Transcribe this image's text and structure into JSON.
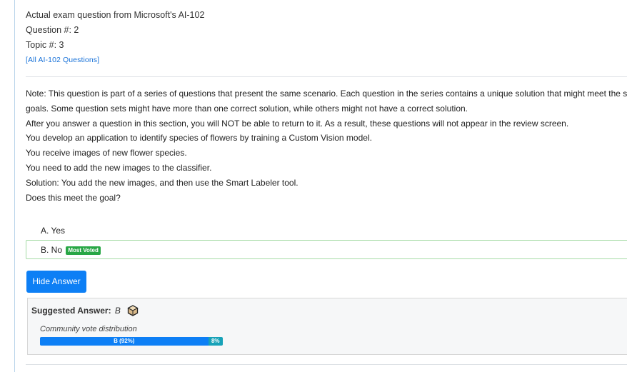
{
  "header": {
    "exam_line": "Actual exam question from Microsoft's AI-102",
    "question_number": "Question #: 2",
    "topic_number": "Topic #: 3",
    "all_questions_link": "[All AI-102 Questions]"
  },
  "question": {
    "lines": [
      "Note: This question is part of a series of questions that present the same scenario. Each question in the series contains a unique solution that might meet the stated",
      "goals. Some question sets might have more than one correct solution, while others might not have a correct solution.",
      "After you answer a question in this section, you will NOT be able to return to it. As a result, these questions will not appear in the review screen.",
      "You develop an application to identify species of flowers by training a Custom Vision model.",
      "You receive images of new flower species.",
      "You need to add the new images to the classifier.",
      "Solution: You add the new images, and then use the Smart Labeler tool.",
      "Does this meet the goal?"
    ]
  },
  "choices": [
    {
      "label": "A. Yes",
      "badge": ""
    },
    {
      "label": "B. No",
      "badge": "Most Voted"
    }
  ],
  "hide_answer_button": "Hide Answer",
  "answer": {
    "label": "Suggested Answer:",
    "value": "B",
    "icon": "hexagon-box-icon"
  },
  "community": {
    "label": "Community vote distribution",
    "segments": [
      {
        "label": "B (92%)",
        "percent": 92,
        "color": "#0d7ff5"
      },
      {
        "label": "8%",
        "percent": 8,
        "color": "#17a2b8"
      }
    ]
  },
  "colors": {
    "link": "#1a73d9",
    "primary": "#0d7ff5",
    "most_voted_badge": "#28a745",
    "correct_border": "#a6dba6"
  }
}
